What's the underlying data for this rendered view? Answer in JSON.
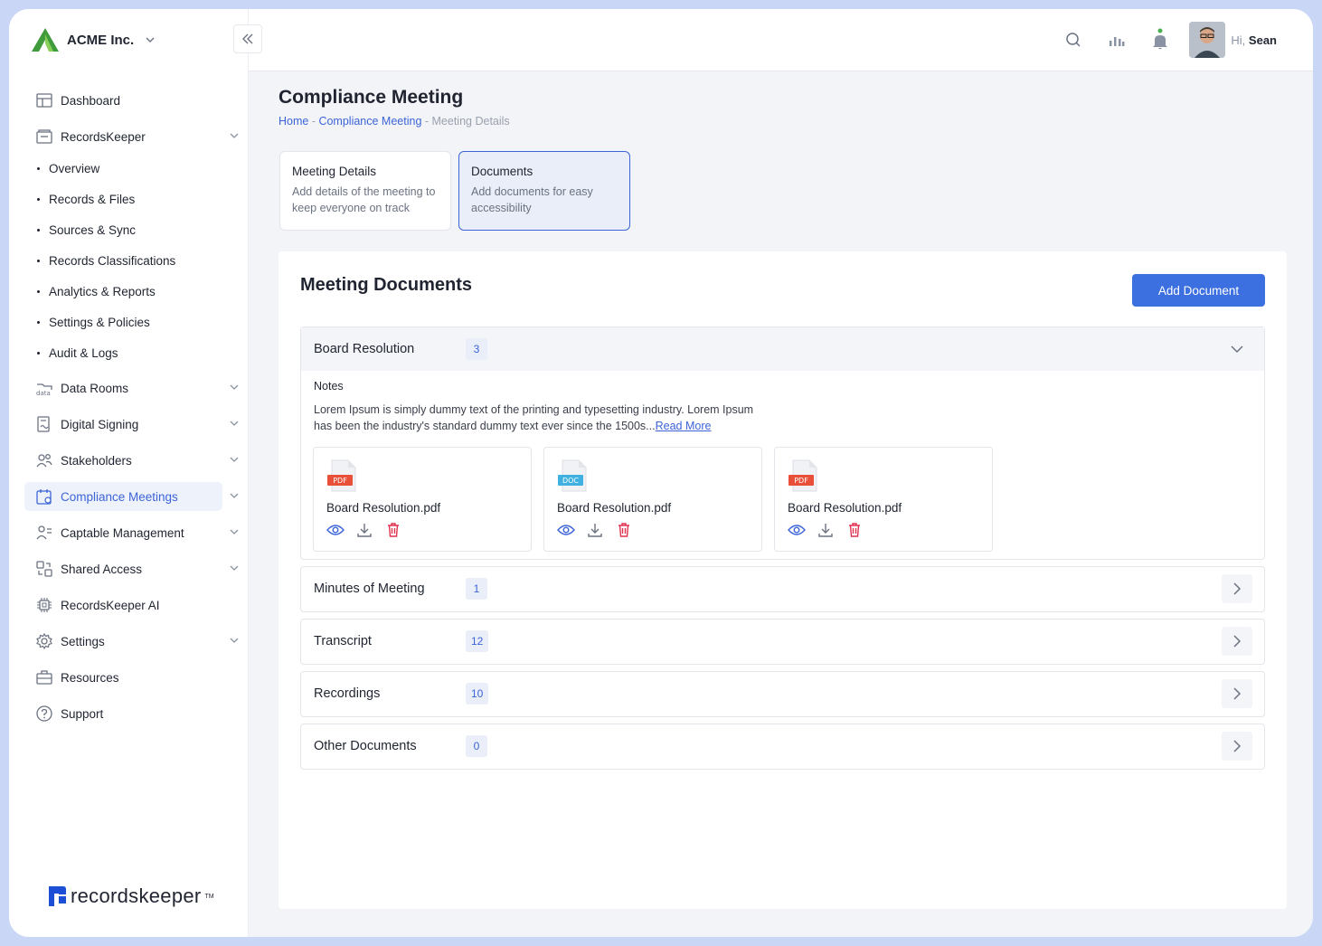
{
  "brand": {
    "name": "ACME Inc.",
    "logo_icon": "acme-a-logo"
  },
  "topbar": {
    "greeting_prefix": "Hi,",
    "user_name": "Sean"
  },
  "sidebar": {
    "items": [
      {
        "label": "Dashboard",
        "icon": "dashboard-icon"
      },
      {
        "label": "RecordsKeeper",
        "icon": "folder-icon",
        "expandable": true
      },
      {
        "label": "Data Rooms",
        "icon": "data-icon",
        "expandable": true
      },
      {
        "label": "Digital Signing",
        "icon": "signing-icon",
        "expandable": true
      },
      {
        "label": "Stakeholders",
        "icon": "users-icon",
        "expandable": true
      },
      {
        "label": "Compliance Meetings",
        "icon": "calendar-icon",
        "expandable": true,
        "active": true
      },
      {
        "label": "Captable Management",
        "icon": "captable-icon",
        "expandable": true
      },
      {
        "label": "Shared Access",
        "icon": "share-icon",
        "expandable": true
      },
      {
        "label": "RecordsKeeper AI",
        "icon": "chip-icon"
      },
      {
        "label": "Settings",
        "icon": "gear-icon",
        "expandable": true
      },
      {
        "label": "Resources",
        "icon": "briefcase-icon"
      },
      {
        "label": "Support",
        "icon": "help-icon"
      }
    ],
    "subitems": [
      "Overview",
      "Records & Files",
      "Sources & Sync",
      "Records Classifications",
      "Analytics & Reports",
      "Settings & Policies",
      "Audit & Logs"
    ],
    "footer_logo_text": "recordskeeper",
    "footer_logo_tm": "TM"
  },
  "page": {
    "title": "Compliance Meeting",
    "breadcrumb": {
      "home": "Home",
      "sep1": " - ",
      "parent": "Compliance Meeting",
      "sep2": " - ",
      "current": "Meeting Details"
    }
  },
  "steps": [
    {
      "title": "Meeting Details",
      "desc": "Add details of the meeting to keep everyone on track"
    },
    {
      "title": "Documents",
      "desc": "Add documents for easy accessibility"
    }
  ],
  "documents": {
    "title": "Meeting Documents",
    "add_label": "Add Document",
    "sections": [
      {
        "title": "Board Resolution",
        "count": "3"
      },
      {
        "title": "Minutes of Meeting",
        "count": "1"
      },
      {
        "title": "Transcript",
        "count": "12"
      },
      {
        "title": "Recordings",
        "count": "10"
      },
      {
        "title": "Other Documents",
        "count": "0"
      }
    ],
    "notes_label": "Notes",
    "notes_text": "Lorem Ipsum is simply dummy text of the printing and typesetting industry. Lorem Ipsum has been the industry's standard dummy text ever since the 1500s...",
    "read_more": "Read More",
    "files": [
      {
        "name": "Board Resolution.pdf",
        "type": "PDF"
      },
      {
        "name": "Board Resolution.pdf",
        "type": "DOC"
      },
      {
        "name": "Board Resolution.pdf",
        "type": "PDF"
      }
    ]
  },
  "colors": {
    "accent": "#3c64d8",
    "button": "#3c6fe0",
    "delete": "#e0314f",
    "pdf": "#e8503a",
    "doc": "#3fb0e0"
  }
}
